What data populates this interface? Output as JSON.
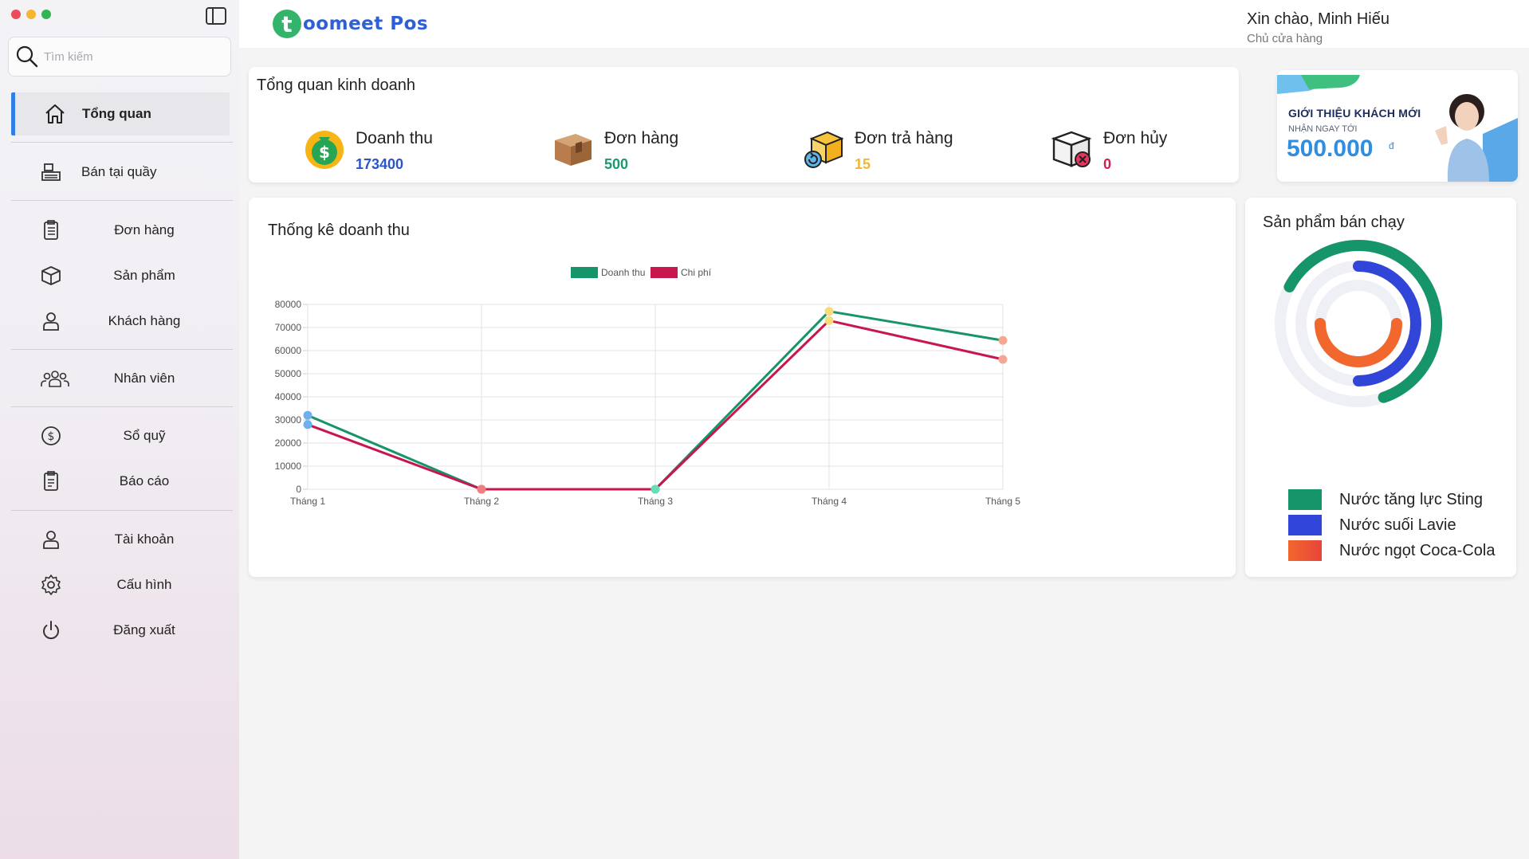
{
  "app": {
    "brand_letter": "t",
    "brand_name": "oomeet Pos"
  },
  "search": {
    "placeholder": "Tìm kiếm"
  },
  "sidebar": {
    "items": [
      {
        "label": "Tổng quan",
        "icon": "home-icon"
      },
      {
        "label": "Bán tại quầy",
        "icon": "cash-register-icon"
      },
      {
        "label": "Đơn hàng",
        "icon": "clipboard-icon"
      },
      {
        "label": "Sản phẩm",
        "icon": "box-icon"
      },
      {
        "label": "Khách hàng",
        "icon": "user-icon"
      },
      {
        "label": "Nhân viên",
        "icon": "users-icon"
      },
      {
        "label": "Sổ quỹ",
        "icon": "dollar-circle-icon"
      },
      {
        "label": "Báo cáo",
        "icon": "report-icon"
      },
      {
        "label": "Tài khoản",
        "icon": "account-icon"
      },
      {
        "label": "Cấu hình",
        "icon": "gear-icon"
      },
      {
        "label": "Đăng xuất",
        "icon": "power-icon"
      }
    ]
  },
  "header": {
    "greeting": "Xin chào, Minh Hiếu",
    "role": "Chủ cửa hàng"
  },
  "overview": {
    "title": "Tổng quan kinh doanh",
    "stats": [
      {
        "label": "Doanh thu",
        "value": "173400",
        "color": "#2b55c9",
        "icon": "money-bag-icon"
      },
      {
        "label": "Đơn hàng",
        "value": "500",
        "color": "#1a9a6c",
        "icon": "package-icon"
      },
      {
        "label": "Đơn trả hàng",
        "value": "15",
        "color": "#f2b632",
        "icon": "return-package-icon"
      },
      {
        "label": "Đơn hủy",
        "value": "0",
        "color": "#d0204e",
        "icon": "cancel-package-icon"
      }
    ]
  },
  "promo": {
    "title": "GIỚI THIỆU KHÁCH MỚI",
    "subtitle": "NHẬN NGAY TỚI",
    "amount": "500.000",
    "currency": "đ"
  },
  "revenue": {
    "title": "Thống kê doanh thu"
  },
  "top_selling": {
    "title": "Sản phẩm bán chạy",
    "items": [
      {
        "label": "Nước tăng lực Sting",
        "color": "#16946a"
      },
      {
        "label": "Nước suối Lavie",
        "color": "#3146d8"
      },
      {
        "label": "Nước ngọt Coca-Cola",
        "color": "#f2672d"
      }
    ]
  },
  "chart_data": [
    {
      "type": "line",
      "categories": [
        "Tháng 1",
        "Tháng 2",
        "Tháng 3",
        "Tháng 4",
        "Tháng 5"
      ],
      "series": [
        {
          "name": "Doanh thu",
          "color": "#16946a",
          "values": [
            32000,
            0,
            0,
            77000,
            64400
          ]
        },
        {
          "name": "Chi phí",
          "color": "#c8174d",
          "values": [
            28000,
            0,
            0,
            73000,
            56200
          ]
        }
      ],
      "ylim": [
        0,
        80000
      ],
      "yticks": [
        "0",
        "10000",
        "20000",
        "30000",
        "40000",
        "50000",
        "60000",
        "70000",
        "80000"
      ],
      "legend": "top",
      "grid": true
    },
    {
      "type": "radial-bar",
      "series": [
        {
          "name": "Nước tăng lực Sting",
          "fraction": 0.62,
          "color": "#16946a"
        },
        {
          "name": "Nước suối Lavie",
          "fraction": 0.5,
          "color": "#3146d8"
        },
        {
          "name": "Nước ngọt Coca-Cola",
          "fraction": 0.5,
          "color": "#f2672d"
        }
      ]
    }
  ]
}
